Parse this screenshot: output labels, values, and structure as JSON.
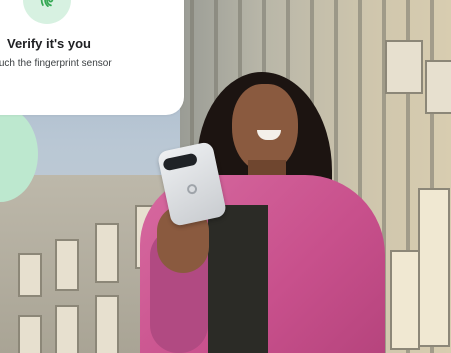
{
  "prompt": {
    "title": "Verify it's you",
    "subtitle": "Touch the fingerprint sensor",
    "icon": "fingerprint-icon",
    "icon_color": "#34a853",
    "badge_color": "#d7f1e1"
  },
  "accent_color": "#bde8cf"
}
